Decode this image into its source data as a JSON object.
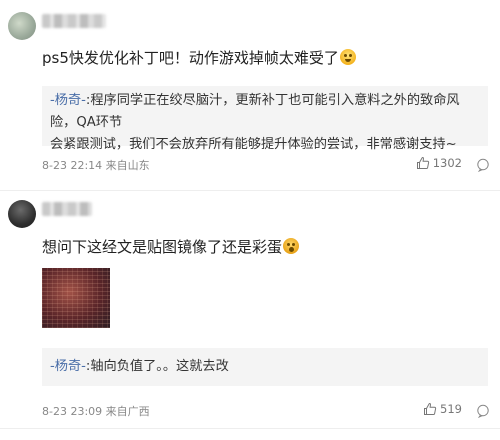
{
  "comments": [
    {
      "text": "ps5快发优化补丁吧！动作游戏掉帧太难受了",
      "reply": {
        "author": "-杨奇-",
        "text": ":程序同学正在绞尽脑汁，更新补丁也可能引入意料之外的致命风险，QA环节",
        "text_line2": "会紧跟测试，我们不会放弃所有能够提升体验的尝试，非常感谢支持~"
      },
      "time": "8-23 22:14 来自山东",
      "likes": "1302"
    },
    {
      "text": "想问下这经文是贴图镜像了还是彩蛋",
      "reply": {
        "author": "-杨奇-",
        "text": ":轴向负值了。。这就去改"
      },
      "time": "8-23 23:09 来自广西",
      "likes": "519"
    }
  ],
  "icons": {
    "like": "thumbs-up-icon",
    "reply": "comment-bubble-icon",
    "emoji": "emoji-icon"
  },
  "colors": {
    "reply_author": "#4a6ea8",
    "reply_bg": "#f4f4f4",
    "meta": "#888888"
  }
}
